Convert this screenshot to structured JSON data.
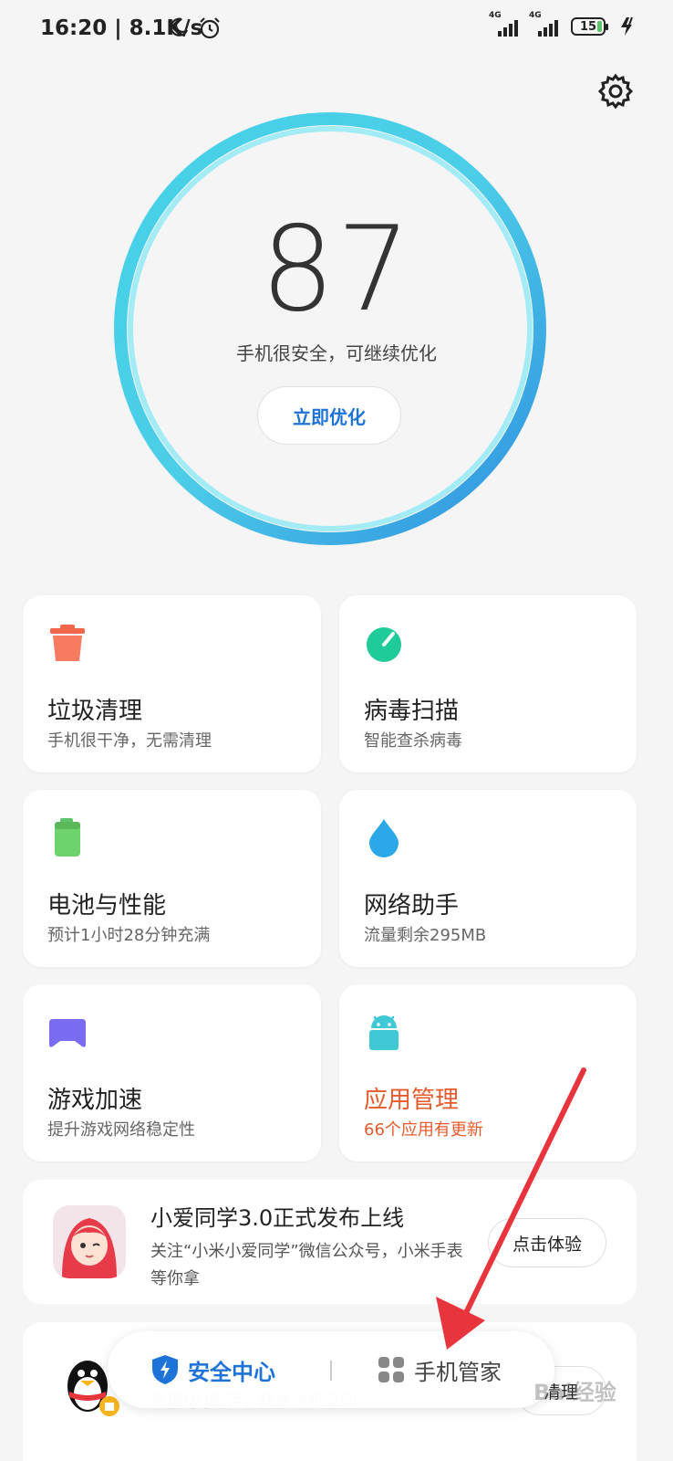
{
  "status_bar": {
    "time": "16:20",
    "net_speed": "8.1K/s",
    "sim1": "4G",
    "sim2": "4G",
    "battery": "15"
  },
  "score": {
    "value": "87",
    "subtitle": "手机很安全，可继续优化",
    "optimize_label": "立即优化"
  },
  "cards": [
    {
      "title": "垃圾清理",
      "subtitle": "手机很干净，无需清理",
      "icon": "trash-icon",
      "color": "#f2654d"
    },
    {
      "title": "病毒扫描",
      "subtitle": "智能查杀病毒",
      "icon": "scan-icon",
      "color": "#1ecb99"
    },
    {
      "title": "电池与性能",
      "subtitle": "预计1小时28分钟充满",
      "icon": "battery-icon",
      "color": "#6fd36b"
    },
    {
      "title": "网络助手",
      "subtitle": "流量剩余295MB",
      "icon": "droplet-icon",
      "color": "#2aa8e8"
    },
    {
      "title": "游戏加速",
      "subtitle": "提升游戏网络稳定性",
      "icon": "gamepad-icon",
      "color": "#7a6cf0"
    },
    {
      "title": "应用管理",
      "subtitle": "66个应用有更新",
      "icon": "android-icon",
      "color": "#41c8d6"
    }
  ],
  "promo1": {
    "title": "小爱同学3.0正式发布上线",
    "desc": "关注“小米小爱同学”微信公众号，小米手表等你拿",
    "button": "点击体验"
  },
  "promo2": {
    "desc": "清理QQ缓存，释放手机空间",
    "button": "清理"
  },
  "bottom_bar": {
    "security_label": "安全中心",
    "manager_label": "手机管家"
  },
  "watermark": "Bai经验",
  "colors": {
    "accent_blue": "#1e73d8",
    "warning_orange": "#e65a2c",
    "annotation_red": "#e8343c"
  }
}
